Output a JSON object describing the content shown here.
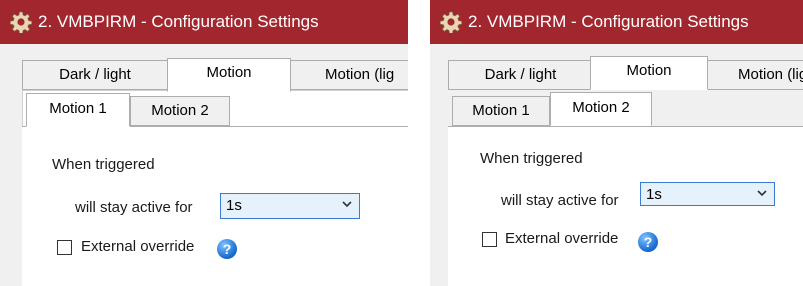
{
  "window_title": "2. VMBPIRM - Configuration Settings",
  "icons": {
    "title": "gear-icon",
    "help": "help-icon",
    "dropdown": "chevron-down-icon"
  },
  "colors": {
    "titlebar": "#a2262e",
    "select_bg": "#e5f1fb",
    "select_border": "#3a7bd5"
  },
  "outer_tabs": [
    "Dark / light",
    "Motion",
    "Motion (lig"
  ],
  "inner_tabs": [
    "Motion 1",
    "Motion 2"
  ],
  "left": {
    "active_outer_tab": "Motion",
    "active_inner_tab": "Motion 1",
    "when_triggered_label": "When triggered",
    "stay_active_label": "will stay active for",
    "duration_value": "1s",
    "external_override_label": "External override",
    "external_override_checked": false
  },
  "right": {
    "active_outer_tab": "Motion",
    "active_inner_tab": "Motion 2",
    "when_triggered_label": "When triggered",
    "stay_active_label": "will stay active for",
    "duration_value": "1s",
    "external_override_label": "External override",
    "external_override_checked": false
  }
}
